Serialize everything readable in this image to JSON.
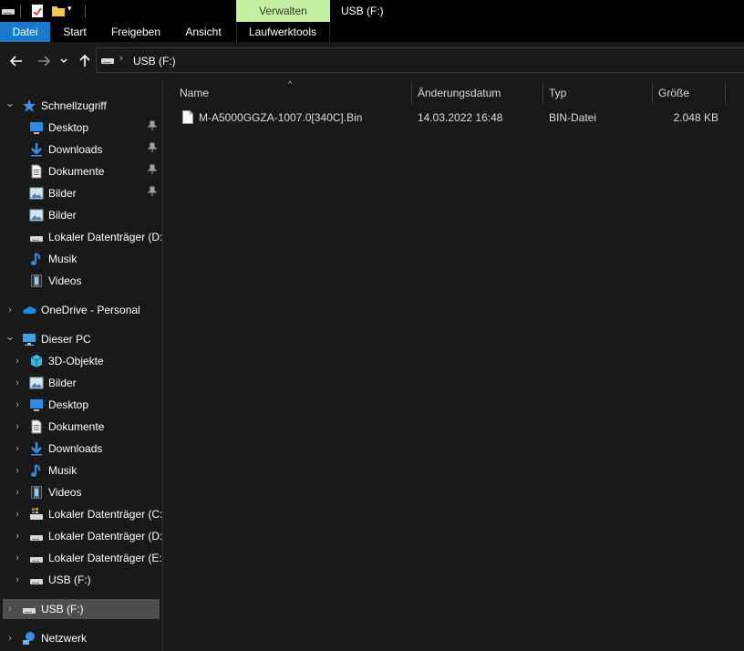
{
  "titlebar": {
    "context_tab": "Verwalten",
    "window_title": "USB (F:)"
  },
  "ribbon": {
    "tabs": [
      "Datei",
      "Start",
      "Freigeben",
      "Ansicht",
      "Laufwerktools"
    ]
  },
  "address": {
    "path": "USB (F:)"
  },
  "sidebar": {
    "quick_access": "Schnellzugriff",
    "quick_items": [
      {
        "label": "Desktop",
        "icon": "desktop-icon",
        "pinned": true
      },
      {
        "label": "Downloads",
        "icon": "download-icon",
        "pinned": true
      },
      {
        "label": "Dokumente",
        "icon": "document-icon",
        "pinned": true
      },
      {
        "label": "Bilder",
        "icon": "pictures-icon",
        "pinned": true
      },
      {
        "label": "Bilder",
        "icon": "pictures-icon",
        "pinned": false
      },
      {
        "label": "Lokaler Datenträger (D:)",
        "icon": "drive-icon",
        "pinned": false
      },
      {
        "label": "Musik",
        "icon": "music-icon",
        "pinned": false
      },
      {
        "label": "Videos",
        "icon": "videos-icon",
        "pinned": false
      }
    ],
    "onedrive": "OneDrive - Personal",
    "this_pc": "Dieser PC",
    "pc_items": [
      {
        "label": "3D-Objekte",
        "icon": "3d-objects-icon"
      },
      {
        "label": "Bilder",
        "icon": "pictures-icon"
      },
      {
        "label": "Desktop",
        "icon": "desktop-icon"
      },
      {
        "label": "Dokumente",
        "icon": "document-icon"
      },
      {
        "label": "Downloads",
        "icon": "download-icon"
      },
      {
        "label": "Musik",
        "icon": "music-icon"
      },
      {
        "label": "Videos",
        "icon": "videos-icon"
      },
      {
        "label": "Lokaler Datenträger (C:)",
        "icon": "system-drive-icon"
      },
      {
        "label": "Lokaler Datenträger (D:)",
        "icon": "drive-icon"
      },
      {
        "label": "Lokaler Datenträger (E:)",
        "icon": "drive-icon"
      },
      {
        "label": "USB (F:)",
        "icon": "usb-drive-icon"
      }
    ],
    "usb_root": "USB (F:)",
    "network": "Netzwerk"
  },
  "filelist": {
    "columns": [
      "Name",
      "Änderungsdatum",
      "Typ",
      "Größe"
    ],
    "files": [
      {
        "name": "M-A5000GGZA-1007.0[340C].Bin",
        "modified": "14.03.2022 16:48",
        "type": "BIN-Datei",
        "size": "2.048 KB"
      }
    ]
  },
  "colors": {
    "accent": "#1979ca",
    "context_tab": "#c5f0a3",
    "background": "#191919",
    "selection": "#4d4d4d"
  }
}
